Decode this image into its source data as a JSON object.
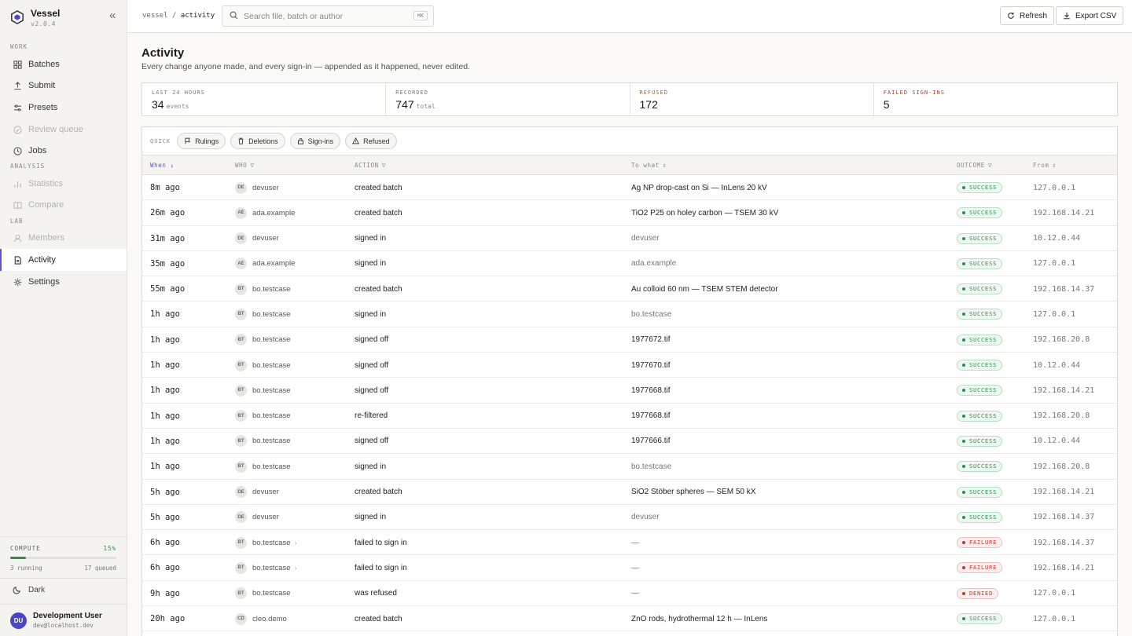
{
  "app": {
    "name": "Vessel",
    "version": "v2.0.4"
  },
  "sidebar": {
    "sections": {
      "work": "WORK",
      "analysis": "ANALYSIS",
      "lab": "LAB"
    },
    "items": [
      {
        "label": "Batches",
        "icon": "grid-icon"
      },
      {
        "label": "Submit",
        "icon": "upload-icon"
      },
      {
        "label": "Presets",
        "icon": "sliders-icon"
      },
      {
        "label": "Review queue",
        "icon": "check-circle-icon"
      },
      {
        "label": "Jobs",
        "icon": "clock-icon"
      },
      {
        "label": "Statistics",
        "icon": "bar-chart-icon"
      },
      {
        "label": "Compare",
        "icon": "columns-icon"
      },
      {
        "label": "Members",
        "icon": "user-icon"
      },
      {
        "label": "Activity",
        "icon": "document-icon"
      },
      {
        "label": "Settings",
        "icon": "gear-icon"
      }
    ],
    "compute": {
      "label": "COMPUTE",
      "percent": "15%",
      "fraction": 0.15,
      "running": "3 running",
      "queued": "17 queued"
    },
    "theme_label": "Dark",
    "user": {
      "initials": "DU",
      "name": "Development User",
      "email": "dev@localhost.dev"
    }
  },
  "topbar": {
    "breadcrumb": {
      "root": "vessel",
      "sep": "/",
      "current": "activity"
    },
    "search": {
      "placeholder": "Search file, batch or author",
      "shortcut": "⌘K"
    },
    "refresh_label": "Refresh",
    "export_label": "Export CSV"
  },
  "page": {
    "title": "Activity",
    "subtitle": "Every change anyone made, and every sign-in — appended as it happened, never edited."
  },
  "stats": [
    {
      "label": "LAST 24 HOURS",
      "value": "34",
      "unit": "events"
    },
    {
      "label": "RECORDED",
      "value": "747",
      "unit": "total"
    },
    {
      "label": "REFUSED",
      "value": "172",
      "unit": ""
    },
    {
      "label": "FAILED SIGN-INS",
      "value": "5",
      "unit": ""
    }
  ],
  "quick": {
    "label": "QUICK",
    "chips": [
      {
        "label": "Rulings",
        "icon": "flag-icon"
      },
      {
        "label": "Deletions",
        "icon": "trash-icon"
      },
      {
        "label": "Sign-ins",
        "icon": "lock-icon"
      },
      {
        "label": "Refused",
        "icon": "warning-icon"
      }
    ]
  },
  "table": {
    "headers": {
      "when": "When ↓",
      "who": "WHO",
      "action": "ACTION",
      "target": "To what",
      "outcome": "OUTCOME",
      "from": "From"
    },
    "rows": [
      {
        "when": "8m ago",
        "initials": "DE",
        "who": "devuser",
        "action": "created batch",
        "target": "Ag NP drop-cast on Si — InLens 20 kV",
        "outcome": "SUCCESS",
        "from": "127.0.0.1"
      },
      {
        "when": "26m ago",
        "initials": "AE",
        "who": "ada.example",
        "action": "created batch",
        "target": "TiO2 P25 on holey carbon — TSEM 30 kV",
        "outcome": "SUCCESS",
        "from": "192.168.14.21"
      },
      {
        "when": "31m ago",
        "initials": "DE",
        "who": "devuser",
        "action": "signed in",
        "target": "devuser",
        "outcome": "SUCCESS",
        "from": "10.12.0.44"
      },
      {
        "when": "35m ago",
        "initials": "AE",
        "who": "ada.example",
        "action": "signed in",
        "target": "ada.example",
        "outcome": "SUCCESS",
        "from": "127.0.0.1"
      },
      {
        "when": "55m ago",
        "initials": "BT",
        "who": "bo.testcase",
        "action": "created batch",
        "target": "Au colloid 60 nm — TSEM STEM detector",
        "outcome": "SUCCESS",
        "from": "192.168.14.37"
      },
      {
        "when": "1h ago",
        "initials": "BT",
        "who": "bo.testcase",
        "action": "signed in",
        "target": "bo.testcase",
        "outcome": "SUCCESS",
        "from": "127.0.0.1"
      },
      {
        "when": "1h ago",
        "initials": "BT",
        "who": "bo.testcase",
        "action": "signed off",
        "target": "1977672.tif",
        "outcome": "SUCCESS",
        "from": "192.168.20.8"
      },
      {
        "when": "1h ago",
        "initials": "BT",
        "who": "bo.testcase",
        "action": "signed off",
        "target": "1977670.tif",
        "outcome": "SUCCESS",
        "from": "10.12.0.44"
      },
      {
        "when": "1h ago",
        "initials": "BT",
        "who": "bo.testcase",
        "action": "signed off",
        "target": "1977668.tif",
        "outcome": "SUCCESS",
        "from": "192.168.14.21"
      },
      {
        "when": "1h ago",
        "initials": "BT",
        "who": "bo.testcase",
        "action": "re-filtered",
        "target": "1977668.tif",
        "outcome": "SUCCESS",
        "from": "192.168.20.8"
      },
      {
        "when": "1h ago",
        "initials": "BT",
        "who": "bo.testcase",
        "action": "signed off",
        "target": "1977666.tif",
        "outcome": "SUCCESS",
        "from": "10.12.0.44"
      },
      {
        "when": "1h ago",
        "initials": "BT",
        "who": "bo.testcase",
        "action": "signed in",
        "target": "bo.testcase",
        "outcome": "SUCCESS",
        "from": "192.168.20.8"
      },
      {
        "when": "5h ago",
        "initials": "DE",
        "who": "devuser",
        "action": "created batch",
        "target": "SiO2 Stöber spheres — SEM 50 kX",
        "outcome": "SUCCESS",
        "from": "192.168.14.21"
      },
      {
        "when": "5h ago",
        "initials": "DE",
        "who": "devuser",
        "action": "signed in",
        "target": "devuser",
        "outcome": "SUCCESS",
        "from": "192.168.14.37"
      },
      {
        "when": "6h ago",
        "initials": "BT",
        "who": "bo.testcase",
        "action": "failed to sign in",
        "target": "—",
        "outcome": "FAILURE",
        "from": "192.168.14.37"
      },
      {
        "when": "6h ago",
        "initials": "BT",
        "who": "bo.testcase",
        "action": "failed to sign in",
        "target": "—",
        "outcome": "FAILURE",
        "from": "192.168.14.21"
      },
      {
        "when": "9h ago",
        "initials": "BT",
        "who": "bo.testcase",
        "action": "was refused",
        "target": "—",
        "outcome": "DENIED",
        "from": "127.0.0.1"
      },
      {
        "when": "20h ago",
        "initials": "CD",
        "who": "cleo.demo",
        "action": "created batch",
        "target": "ZnO rods, hydrothermal 12 h — InLens",
        "outcome": "SUCCESS",
        "from": "127.0.0.1"
      }
    ]
  },
  "colors": {
    "accent": "#5b55d6",
    "success": "#2e8a4e",
    "failure": "#c0392b",
    "refused_label": "#b36a1c"
  }
}
